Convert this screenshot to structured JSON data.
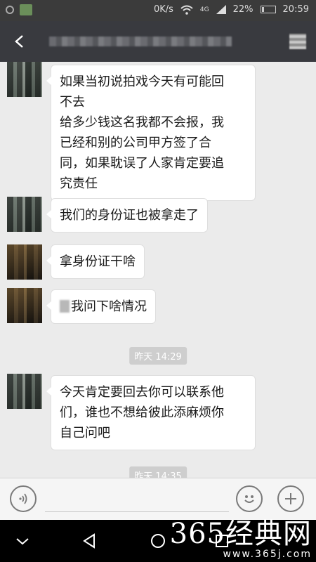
{
  "status_bar": {
    "network": "0K/s",
    "signal_label": "4G",
    "battery": "22%",
    "time": "20:59"
  },
  "messages": [
    {
      "lines": [
        "如果当初说拍戏今天有可能回",
        "不去",
        "给多少钱这名我都不会报，我",
        "已经和别的公司甲方签了合",
        "同，如果耽误了人家肯定要追",
        "究责任"
      ]
    },
    {
      "lines": [
        "我们的身份证也被拿走了"
      ]
    },
    {
      "lines": [
        "拿身份证干啥"
      ]
    },
    {
      "lines": [
        "我问下啥情况"
      ]
    },
    {
      "lines": [
        "今天肯定要回去你可以联系他",
        "们，谁也不想给彼此添麻烦你",
        "自己问吧"
      ]
    }
  ],
  "timestamps": [
    "昨天 14:29",
    "昨天 14:35"
  ],
  "watermark": {
    "main": "365经典网",
    "sub": "www.365j.com"
  },
  "icons": {
    "back": "back-arrow-icon",
    "profile": "profile-icon",
    "voice": "voice-icon",
    "emoji": "emoji-icon",
    "plus": "plus-icon",
    "nav_back": "nav-back-icon",
    "nav_home": "nav-home-icon",
    "nav_recents": "nav-recents-icon"
  },
  "colors": {
    "title_bar": "#393a3f",
    "chat_background": "#ebebeb",
    "bubble": "#ffffff",
    "timestamp_chip": "#cecece"
  }
}
